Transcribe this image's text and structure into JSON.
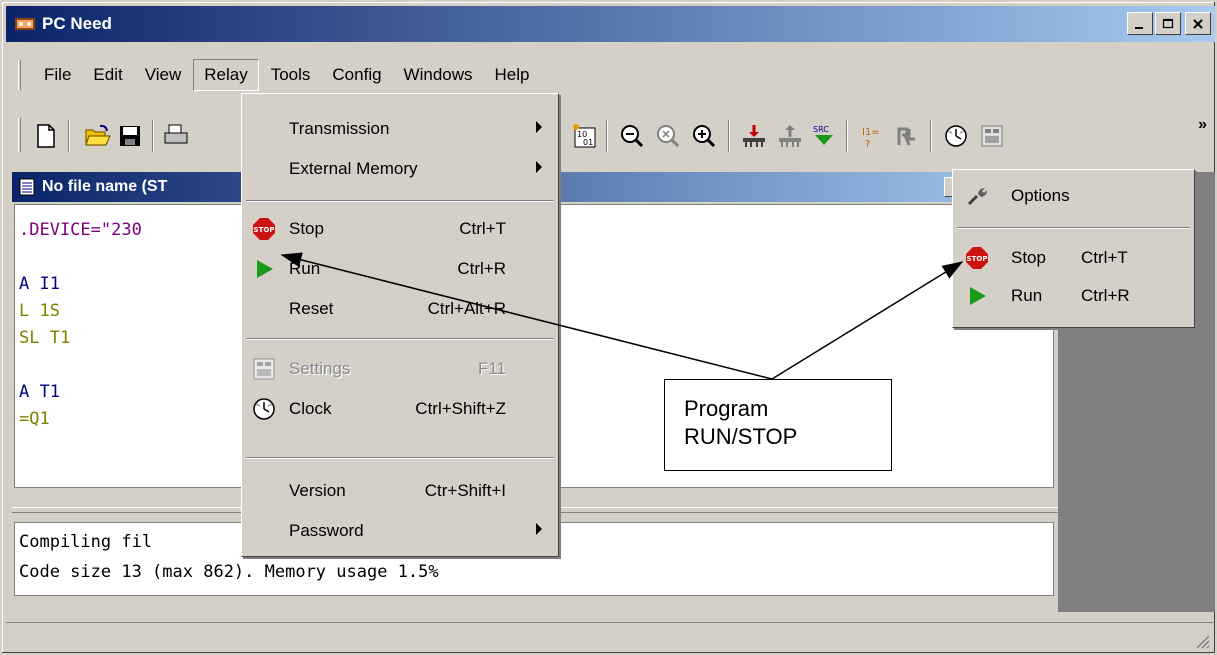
{
  "window": {
    "title": "PC Need",
    "minimize_label": "_",
    "maximize_label": "□",
    "close_label": "×"
  },
  "menubar": {
    "items": [
      "File",
      "Edit",
      "View",
      "Relay",
      "Tools",
      "Config",
      "Windows",
      "Help"
    ],
    "active": "Relay"
  },
  "toolbar": {
    "more_label": "»",
    "icons": [
      "new-file-icon",
      "open-folder-icon",
      "save-icon",
      "print-icon",
      "binary-icon",
      "zoom-out-icon",
      "zoom-reset-icon",
      "zoom-in-icon",
      "transfer-down-icon",
      "transfer-up-icon",
      "src-icon",
      "ivalue-icon",
      "monitor-icon",
      "clock-icon",
      "settings-icon"
    ],
    "src_label": "SRC",
    "binary_label": "10 01",
    "ivalue_label": "I1="
  },
  "document": {
    "title": "No file name (ST",
    "code_lines": [
      {
        "text": ".DEVICE=\"230",
        "color": "#800080"
      },
      {
        "text": "",
        "color": "#000"
      },
      {
        "text": "A I1",
        "color": "#000080"
      },
      {
        "text": "L 1S",
        "color": "#808000"
      },
      {
        "text": "SL T1",
        "color": "#808000"
      },
      {
        "text": "",
        "color": "#000"
      },
      {
        "text": "A T1",
        "color": "#000080"
      },
      {
        "text": "=Q1",
        "color": "#808000"
      }
    ],
    "output_lines": [
      "Compiling fil",
      "Code size 13 (max 862). Memory usage 1.5%"
    ]
  },
  "relay_menu": {
    "items": [
      {
        "label": "Transmission",
        "shortcut": "",
        "submenu": true,
        "icon": "",
        "disabled": false
      },
      {
        "label": "External Memory",
        "shortcut": "",
        "submenu": true,
        "icon": "",
        "disabled": false
      },
      {
        "label": "Stop",
        "shortcut": "Ctrl+T",
        "submenu": false,
        "icon": "stop-icon",
        "disabled": false
      },
      {
        "label": "Run",
        "shortcut": "Ctrl+R",
        "submenu": false,
        "icon": "run-icon",
        "disabled": false
      },
      {
        "label": "Reset",
        "shortcut": "Ctrl+Alt+R",
        "submenu": false,
        "icon": "",
        "disabled": false
      },
      {
        "label": "Settings",
        "shortcut": "F11",
        "submenu": false,
        "icon": "settings-icon",
        "disabled": true
      },
      {
        "label": "Clock",
        "shortcut": "Ctrl+Shift+Z",
        "submenu": false,
        "icon": "clock-icon",
        "disabled": false
      },
      {
        "label": "Version",
        "shortcut": "Ctr+Shift+I",
        "submenu": false,
        "icon": "",
        "disabled": false
      },
      {
        "label": "Password",
        "shortcut": "",
        "submenu": true,
        "icon": "",
        "disabled": false
      }
    ]
  },
  "context_menu": {
    "items": [
      {
        "label": "Options",
        "shortcut": "",
        "icon": "wrench-icon"
      },
      {
        "label": "Stop",
        "shortcut": "Ctrl+T",
        "icon": "stop-icon"
      },
      {
        "label": "Run",
        "shortcut": "Ctrl+R",
        "icon": "run-icon"
      }
    ]
  },
  "callout": {
    "line1": "Program",
    "line2": "RUN/STOP"
  },
  "colors": {
    "title_gradient_start": "#0a246a",
    "title_gradient_end": "#a6caf0",
    "face": "#d4d0c8",
    "stop_red": "#cc1111",
    "run_green": "#1a9a1a"
  }
}
